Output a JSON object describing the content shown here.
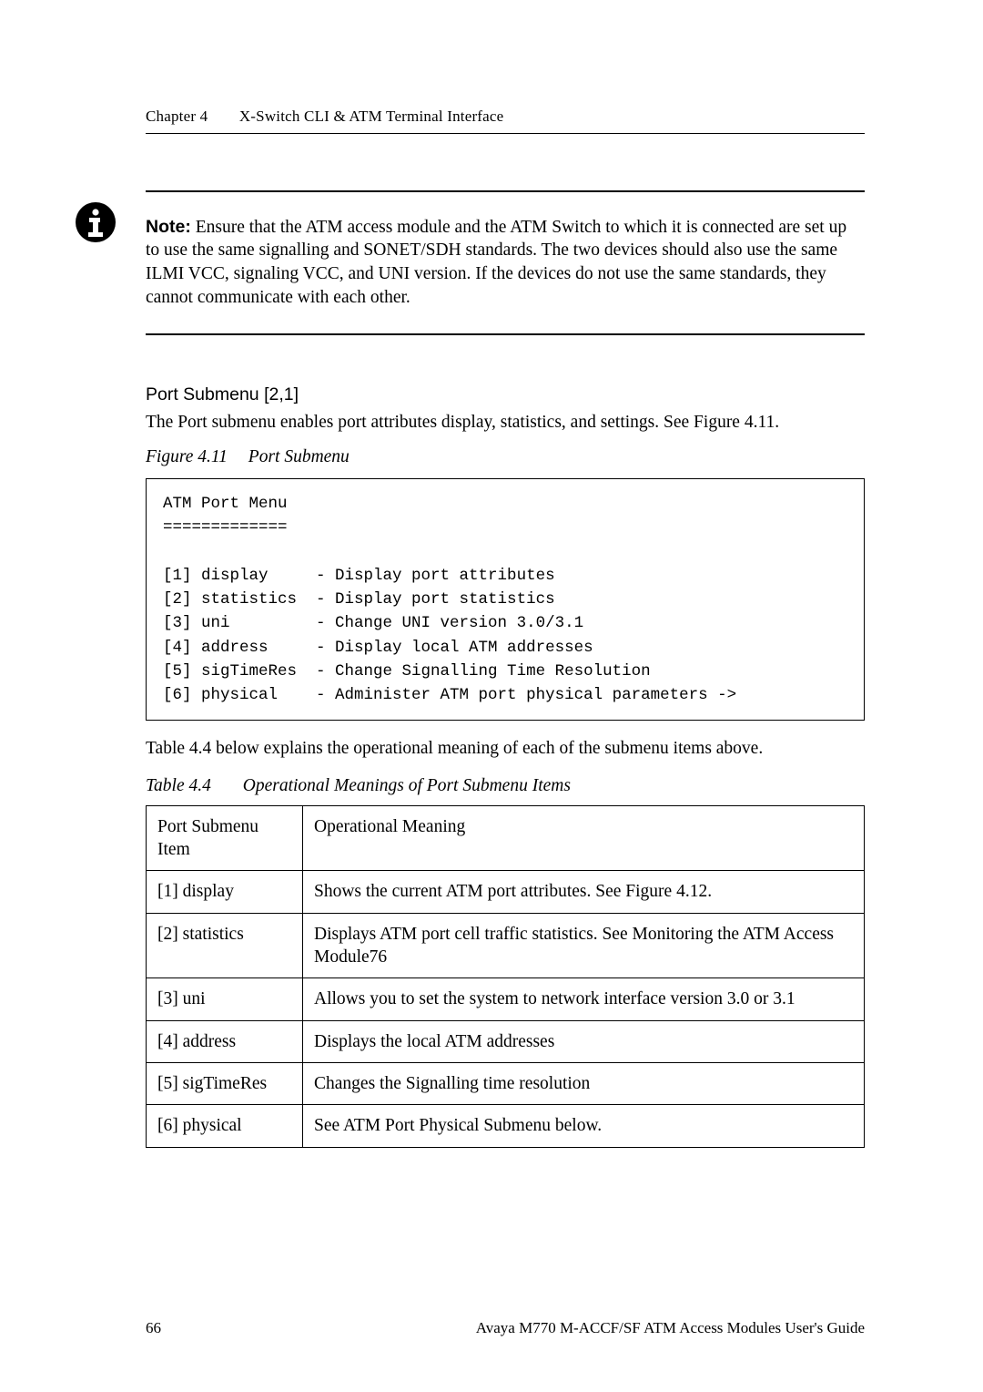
{
  "runningHead": {
    "chapter": "Chapter 4",
    "title": "X-Switch CLI & ATM Terminal Interface"
  },
  "note": {
    "label": "Note:",
    "text": "Ensure that the ATM access module and the ATM Switch to which it is connected are set up to use the same signalling and SONET/SDH standards. The two devices should also use the same ILMI VCC, signaling VCC, and UNI version. If the devices do not use the same standards, they cannot communicate with each other."
  },
  "portSubmenu": {
    "heading": "Port Submenu [2,1]",
    "intro": "The Port submenu enables port attributes display, statistics, and settings. See Figure 4.11."
  },
  "figure": {
    "label": "Figure 4.11",
    "title": "Port Submenu",
    "code": "ATM Port Menu\n=============\n\n[1] display     - Display port attributes\n[2] statistics  - Display port statistics\n[3] uni         - Change UNI version 3.0/3.1\n[4] address     - Display local ATM addresses\n[5] sigTimeRes  - Change Signalling Time Resolution\n[6] physical    - Administer ATM port physical parameters ->"
  },
  "afterFigureText": "Table 4.4 below explains the operational meaning of each of the submenu items above.",
  "table": {
    "label": "Table 4.4",
    "title": "Operational Meanings of Port Submenu Items",
    "headers": {
      "col1": "Port Submenu Item",
      "col2": "Operational Meaning"
    },
    "rows": [
      {
        "item": "[1] display",
        "meaning": "Shows the current ATM port attributes. See Figure 4.12."
      },
      {
        "item": "[2] statistics",
        "meaning": "Displays ATM port cell traffic statistics. See Monitoring the ATM Access Module76"
      },
      {
        "item": "[3] uni",
        "meaning": "Allows you to set the system to network interface version 3.0 or 3.1"
      },
      {
        "item": "[4] address",
        "meaning": "Displays the local ATM addresses"
      },
      {
        "item": "[5] sigTimeRes",
        "meaning": "Changes the Signalling time resolution"
      },
      {
        "item": "[6] physical",
        "meaning": "See ATM Port Physical Submenu below."
      }
    ]
  },
  "footer": {
    "pageNumber": "66",
    "docTitle": "Avaya M770 M-ACCF/SF ATM Access Modules User's Guide"
  },
  "chart_data": {
    "type": "table",
    "title": "Operational Meanings of Port Submenu Items",
    "columns": [
      "Port Submenu Item",
      "Operational Meaning"
    ],
    "rows": [
      [
        "[1] display",
        "Shows the current ATM port attributes. See Figure 4.12."
      ],
      [
        "[2] statistics",
        "Displays ATM port cell traffic statistics. See Monitoring the ATM Access Module76"
      ],
      [
        "[3] uni",
        "Allows you to set the system to network interface version 3.0 or 3.1"
      ],
      [
        "[4] address",
        "Displays the local ATM addresses"
      ],
      [
        "[5] sigTimeRes",
        "Changes the Signalling time resolution"
      ],
      [
        "[6] physical",
        "See ATM Port Physical Submenu below."
      ]
    ]
  }
}
